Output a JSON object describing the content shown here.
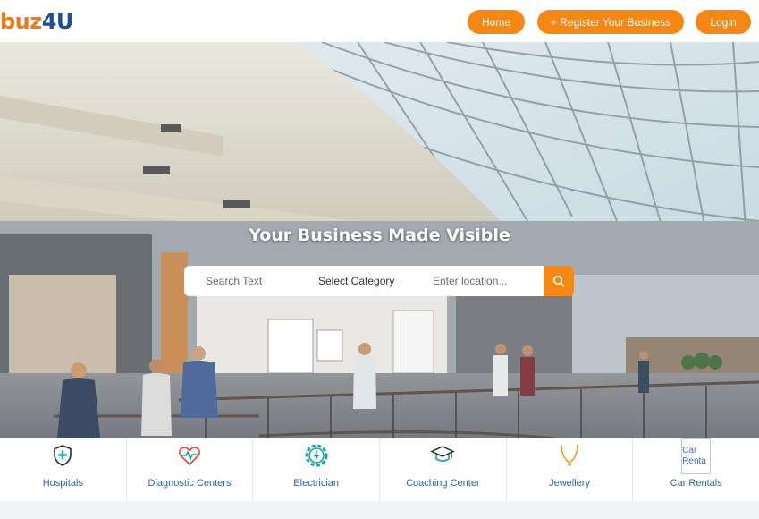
{
  "header": {
    "logo": {
      "part1": "buz",
      "part2": "4U"
    },
    "nav": {
      "home": "Home",
      "register": "+ Register Your Business",
      "login": "Login"
    }
  },
  "hero": {
    "title": "Your Business Made Visible",
    "search": {
      "text_placeholder": "Search Text",
      "category_label": "Select Category",
      "location_placeholder": "Enter location..."
    }
  },
  "categories": [
    {
      "label": "Hospitals",
      "icon": "shield-medical-icon"
    },
    {
      "label": "Diagnostic Centers",
      "icon": "heart-pulse-icon"
    },
    {
      "label": "Electrician",
      "icon": "gear-bolt-icon"
    },
    {
      "label": "Coaching Center",
      "icon": "graduation-cap-icon"
    },
    {
      "label": "Jewellery",
      "icon": "necklace-icon"
    },
    {
      "label": "Car Rentals",
      "icon": "broken-image-icon",
      "alt_text": "Car Renta"
    }
  ],
  "colors": {
    "accent": "#f68712",
    "logo_blue": "#1e4e9c",
    "category_text": "#2a63b4",
    "icon_teal": "#16a3b0"
  }
}
